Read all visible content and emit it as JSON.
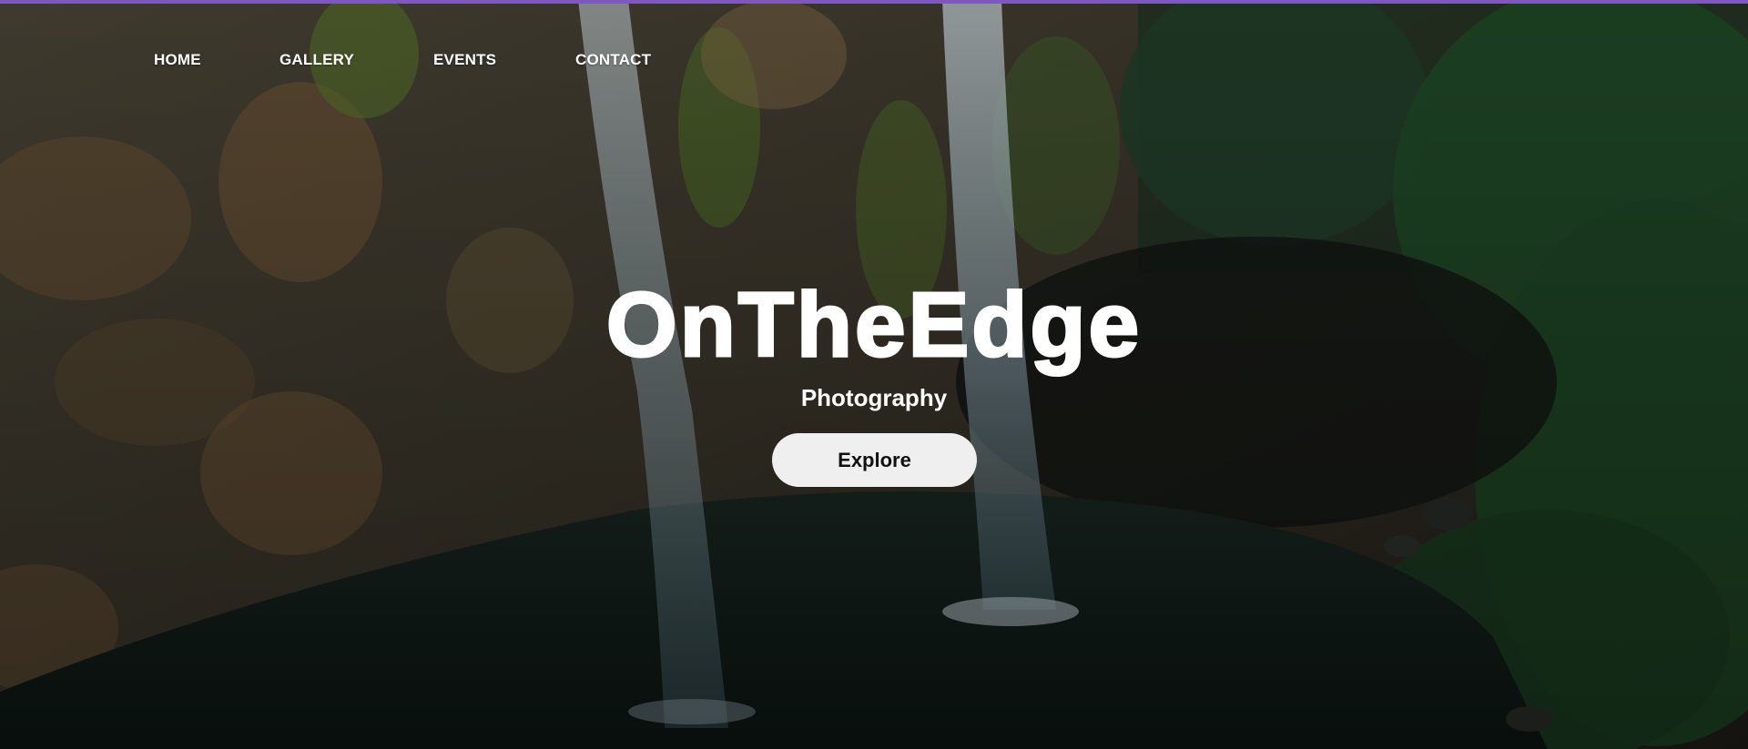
{
  "nav": {
    "items": [
      {
        "label": "HOME"
      },
      {
        "label": "GALLERY"
      },
      {
        "label": "EVENTS"
      },
      {
        "label": "CONTACT"
      }
    ]
  },
  "hero": {
    "title": "OnTheEdge",
    "subtitle": "Photography",
    "cta_label": "Explore",
    "background_description_icon": "waterfall-photo"
  },
  "colors": {
    "accent_bar": "#7e57c2",
    "text": "#ffffff",
    "button_bg": "#efefef",
    "button_text": "#111111"
  }
}
